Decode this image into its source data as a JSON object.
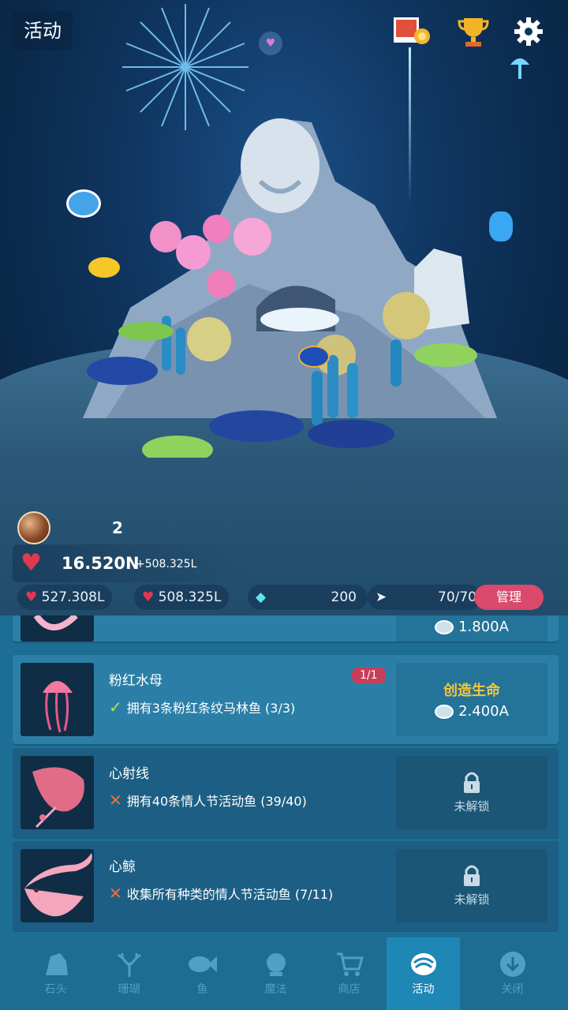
{
  "header": {
    "title": "活动"
  },
  "stats": {
    "pearls": "2",
    "life_total": "16.520N",
    "life_rate": "+508.325L",
    "tap_value": "527.308L",
    "auto_value": "508.325L",
    "gems": "200",
    "fish_capacity": "70/70",
    "manage_label": "管理"
  },
  "list": {
    "partial_card": {
      "cost": "1.800A"
    },
    "cards": [
      {
        "name": "粉红水母",
        "badge": "1/1",
        "condition": "拥有3条粉红条纹马林鱼 (3/3)",
        "met": true,
        "action": "创造生命",
        "cost": "2.400A"
      },
      {
        "name": "心射线",
        "condition": "拥有40条情人节活动鱼 (39/40)",
        "met": false,
        "action": "未解锁"
      },
      {
        "name": "心鲸",
        "condition": "收集所有种类的情人节活动鱼 (7/11)",
        "met": false,
        "action": "未解锁"
      }
    ]
  },
  "nav": {
    "items": [
      {
        "label": "石头",
        "icon": "rock-icon"
      },
      {
        "label": "珊瑚",
        "icon": "coral-icon"
      },
      {
        "label": "鱼",
        "icon": "fish-icon"
      },
      {
        "label": "魔法",
        "icon": "magic-icon"
      },
      {
        "label": "商店",
        "icon": "cart-icon"
      },
      {
        "label": "活动",
        "icon": "event-shell-icon",
        "active": true
      },
      {
        "label": "关闭",
        "icon": "close-down-icon"
      }
    ]
  },
  "colors": {
    "accent_pink": "#d94a6c",
    "create_gold": "#f6c53f",
    "list_bg": "#1c6e95",
    "nav_bg": "#1d6d93"
  }
}
